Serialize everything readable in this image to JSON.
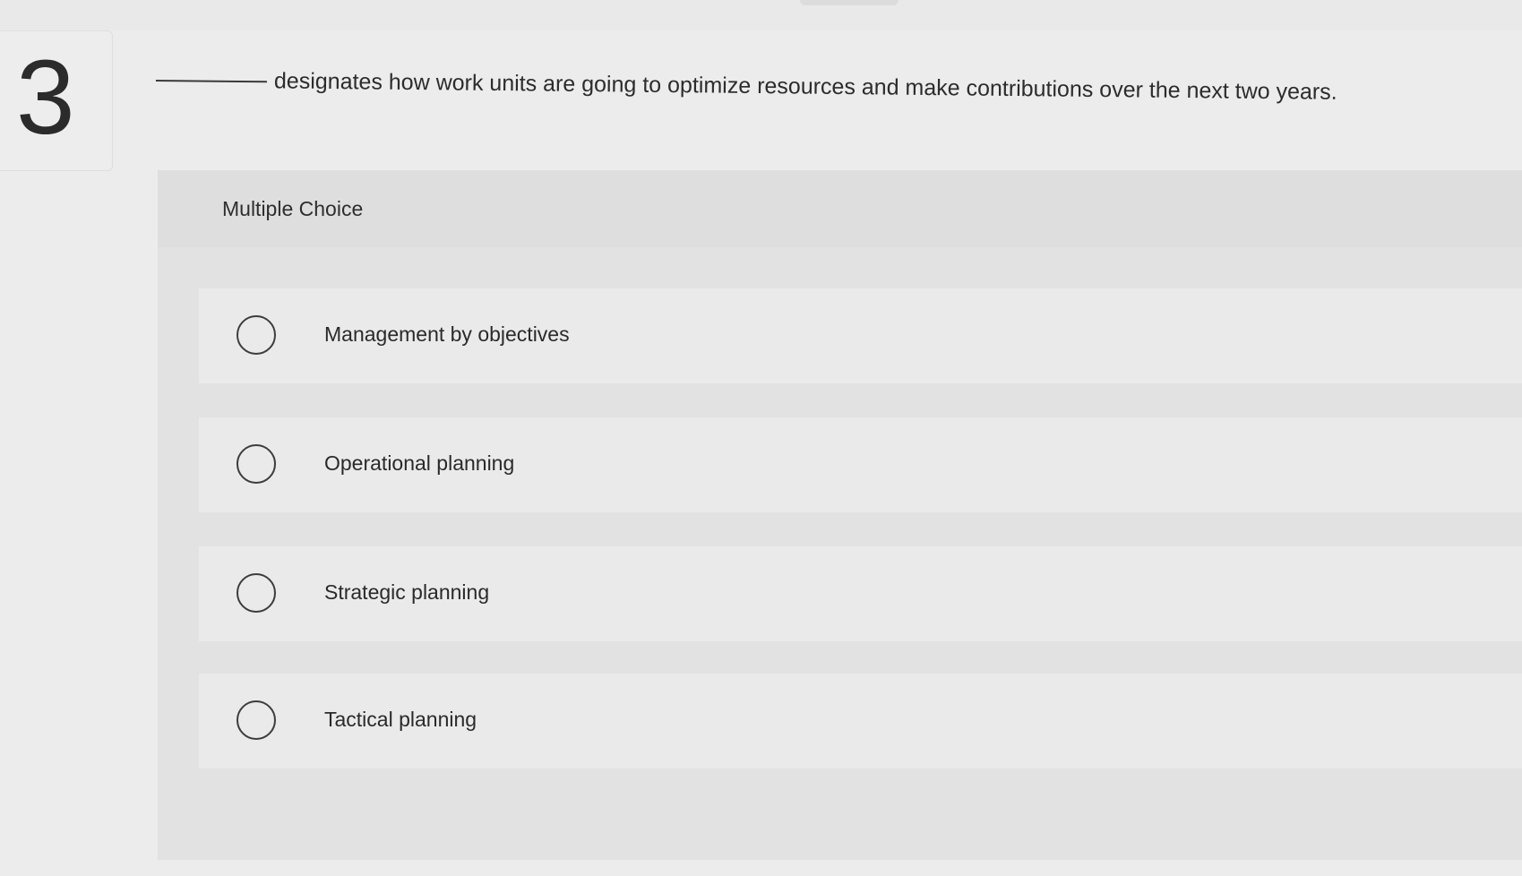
{
  "question": {
    "number": "3",
    "text": "designates how work units are going to optimize resources and make contributions over the next two years."
  },
  "multiple_choice": {
    "label": "Multiple Choice",
    "options": [
      {
        "label": "Management by objectives",
        "selected": false
      },
      {
        "label": "Operational planning",
        "selected": false
      },
      {
        "label": "Strategic planning",
        "selected": false
      },
      {
        "label": "Tactical planning",
        "selected": false
      }
    ]
  },
  "colors": {
    "background": "#ececec",
    "panel": "#e2e2e2",
    "option_row": "#eaeaea",
    "text": "#2a2a2a"
  }
}
